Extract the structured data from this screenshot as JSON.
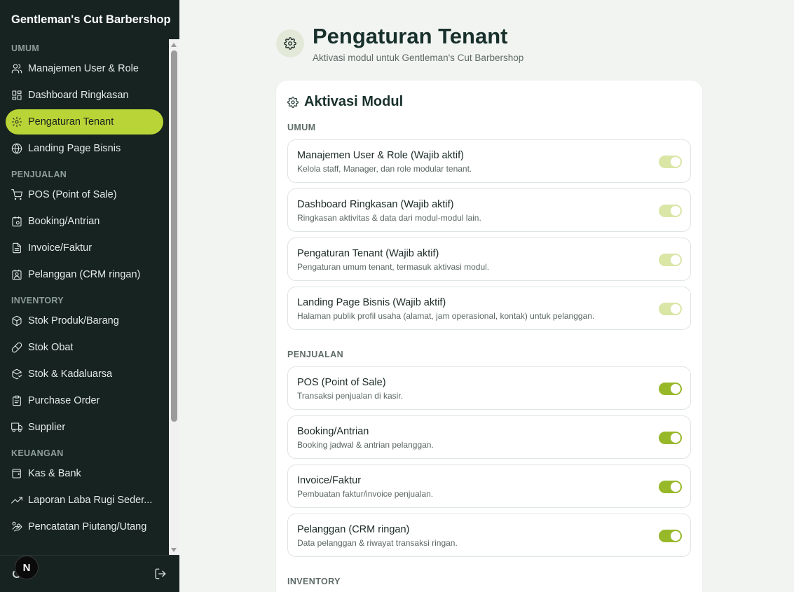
{
  "app": {
    "brand": "Gentleman's Cut Barbershop"
  },
  "sidebar": {
    "sections": [
      {
        "label": "UMUM",
        "items": [
          {
            "label": "Manajemen User & Role",
            "icon": "users-icon"
          },
          {
            "label": "Dashboard Ringkasan",
            "icon": "dashboard-icon"
          },
          {
            "label": "Pengaturan Tenant",
            "icon": "gear-icon",
            "active": true
          },
          {
            "label": "Landing Page Bisnis",
            "icon": "globe-icon"
          }
        ]
      },
      {
        "label": "PENJUALAN",
        "items": [
          {
            "label": "POS (Point of Sale)",
            "icon": "cart-icon"
          },
          {
            "label": "Booking/Antrian",
            "icon": "calendar-clock-icon"
          },
          {
            "label": "Invoice/Faktur",
            "icon": "file-text-icon"
          },
          {
            "label": "Pelanggan (CRM ringan)",
            "icon": "contact-icon"
          }
        ]
      },
      {
        "label": "INVENTORY",
        "items": [
          {
            "label": "Stok Produk/Barang",
            "icon": "package-icon"
          },
          {
            "label": "Stok Obat",
            "icon": "pill-icon"
          },
          {
            "label": "Stok & Kadaluarsa",
            "icon": "package-check-icon"
          },
          {
            "label": "Purchase Order",
            "icon": "clipboard-icon"
          },
          {
            "label": "Supplier",
            "icon": "truck-icon"
          }
        ]
      },
      {
        "label": "KEUANGAN",
        "items": [
          {
            "label": "Kas & Bank",
            "icon": "wallet-icon"
          },
          {
            "label": "Laporan Laba Rugi Seder...",
            "icon": "trending-up-icon"
          },
          {
            "label": "Pencatatan Piutang/Utang",
            "icon": "hand-coins-icon"
          }
        ]
      }
    ],
    "footer": {
      "badge": "N",
      "logout_icon": "logout-icon"
    }
  },
  "header": {
    "title": "Pengaturan Tenant",
    "subtitle": "Aktivasi modul untuk Gentleman's Cut Barbershop"
  },
  "card": {
    "title": "Aktivasi Modul",
    "groups": [
      {
        "label": "UMUM",
        "modules": [
          {
            "name": "Manajemen User & Role (Wajib aktif)",
            "desc": "Kelola staff, Manager, dan role modular tenant.",
            "enabled": true,
            "locked": true
          },
          {
            "name": "Dashboard Ringkasan (Wajib aktif)",
            "desc": "Ringkasan aktivitas & data dari modul-modul lain.",
            "enabled": true,
            "locked": true
          },
          {
            "name": "Pengaturan Tenant (Wajib aktif)",
            "desc": "Pengaturan umum tenant, termasuk aktivasi modul.",
            "enabled": true,
            "locked": true
          },
          {
            "name": "Landing Page Bisnis (Wajib aktif)",
            "desc": "Halaman publik profil usaha (alamat, jam operasional, kontak) untuk pelanggan.",
            "enabled": true,
            "locked": true
          }
        ]
      },
      {
        "label": "PENJUALAN",
        "modules": [
          {
            "name": "POS (Point of Sale)",
            "desc": "Transaksi penjualan di kasir.",
            "enabled": true,
            "locked": false
          },
          {
            "name": "Booking/Antrian",
            "desc": "Booking jadwal & antrian pelanggan.",
            "enabled": true,
            "locked": false
          },
          {
            "name": "Invoice/Faktur",
            "desc": "Pembuatan faktur/invoice penjualan.",
            "enabled": true,
            "locked": false
          },
          {
            "name": "Pelanggan (CRM ringan)",
            "desc": "Data pelanggan & riwayat transaksi ringan.",
            "enabled": true,
            "locked": false
          }
        ]
      },
      {
        "label": "INVENTORY",
        "modules": []
      }
    ]
  },
  "colors": {
    "sidebar_bg": "#172321",
    "accent": "#b9d437",
    "toggle_on": "#97b829",
    "toggle_locked": "#d9e6a6"
  }
}
